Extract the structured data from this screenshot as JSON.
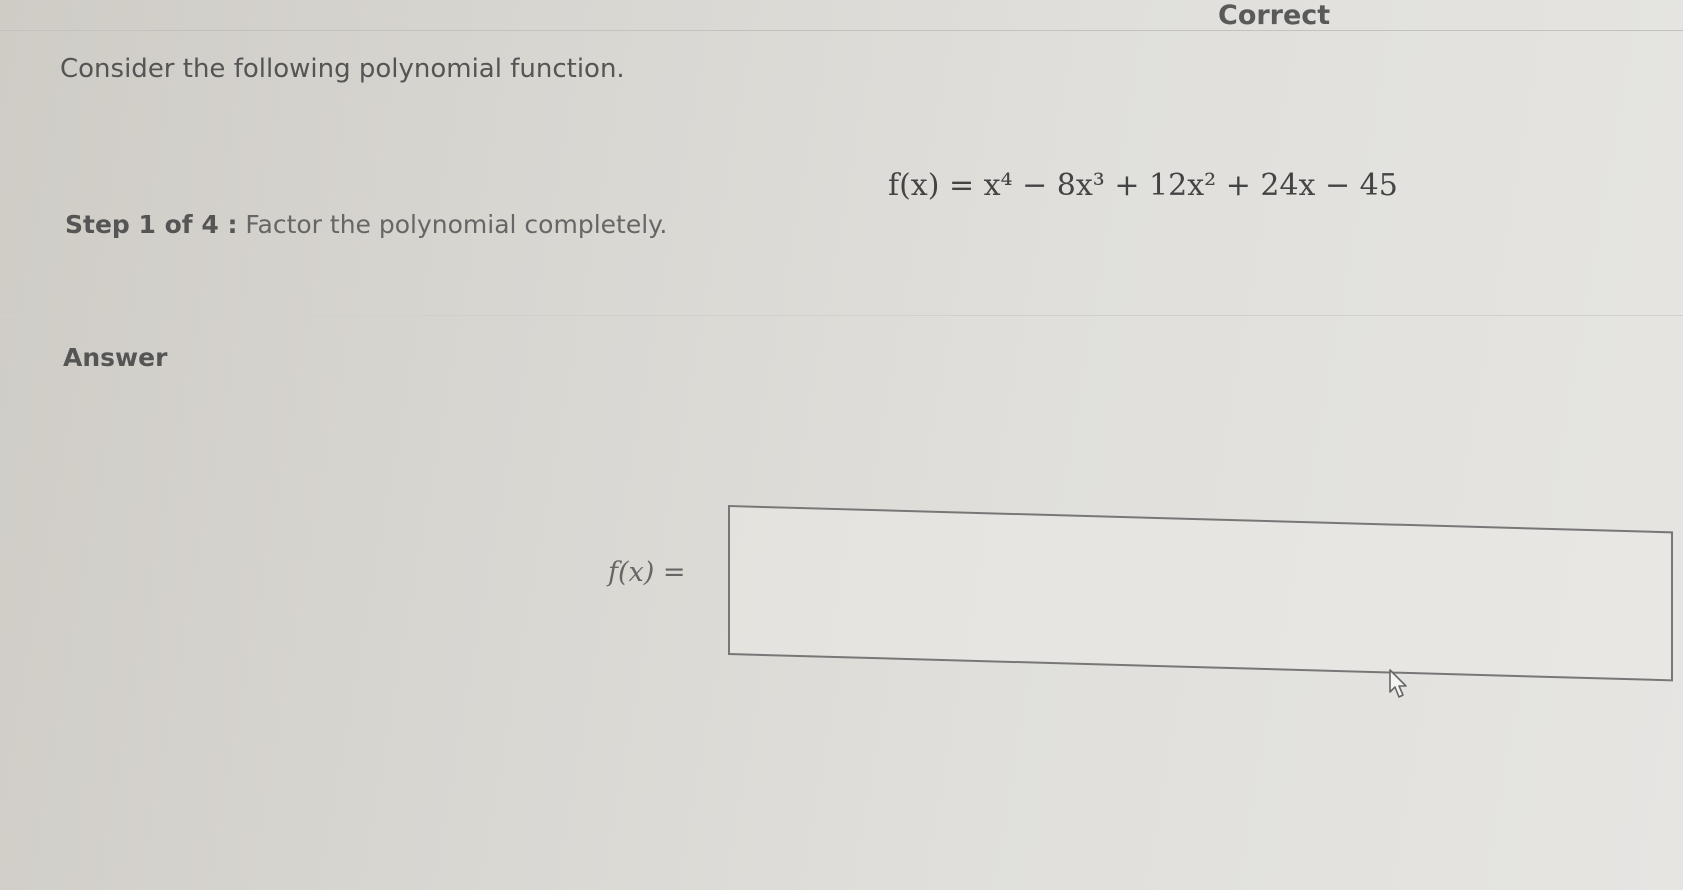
{
  "header": {
    "status": "Correct"
  },
  "question": {
    "prompt": "Consider the following polynomial function.",
    "function": "f(x) = x⁴ − 8x³ + 12x² + 24x − 45",
    "step_label": "Step 1 of 4 :",
    "step_text": "Factor the polynomial completely."
  },
  "answer": {
    "heading": "Answer",
    "label": "f(x) =",
    "value": ""
  },
  "icons": {
    "cursor": "mouse-pointer-icon"
  }
}
